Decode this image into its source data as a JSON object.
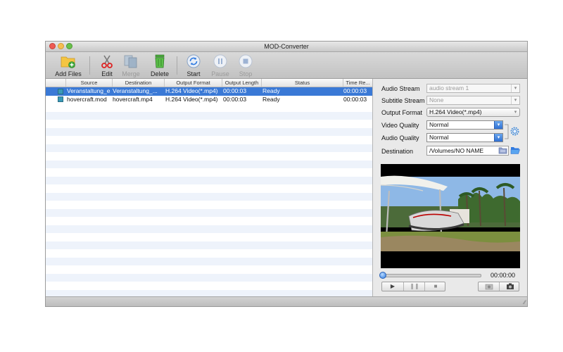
{
  "window": {
    "title": "MOD-Converter"
  },
  "toolbar": {
    "add_files": "Add Files",
    "edit": "Edit",
    "merge": "Merge",
    "delete": "Delete",
    "start": "Start",
    "pause": "Pause",
    "stop": "Stop"
  },
  "table": {
    "columns": [
      "Source",
      "Destination",
      "Output Format",
      "Output Length",
      "Status",
      "Time Re..."
    ],
    "rows": [
      {
        "source": "Veranstaltung_e",
        "destination": "Veranstaltung_...",
        "format": "H.264 Video(*.mp4)",
        "length": "00:00:03",
        "status": "Ready",
        "time": "00:00:03",
        "selected": true
      },
      {
        "source": "hovercraft.mod",
        "destination": "hovercraft.mp4",
        "format": "H.264 Video(*.mp4)",
        "length": "00:00:03",
        "status": "Ready",
        "time": "00:00:03",
        "selected": false
      }
    ]
  },
  "settings": {
    "audio_stream_label": "Audio Stream",
    "audio_stream_value": "audio stream 1",
    "subtitle_stream_label": "Subtitle Stream",
    "subtitle_stream_value": "None",
    "output_format_label": "Output Format",
    "output_format_value": "H.264 Video(*.mp4)",
    "video_quality_label": "Video Quality",
    "video_quality_value": "Normal",
    "audio_quality_label": "Audio Quality",
    "audio_quality_value": "Normal",
    "destination_label": "Destination",
    "destination_value": "/Volumes/NO NAME"
  },
  "player": {
    "time": "00:00:00",
    "progress": 0
  },
  "colors": {
    "selection": "#3a79d6",
    "row_alt": "#eef3fb",
    "accent": "#2f7ae0"
  }
}
